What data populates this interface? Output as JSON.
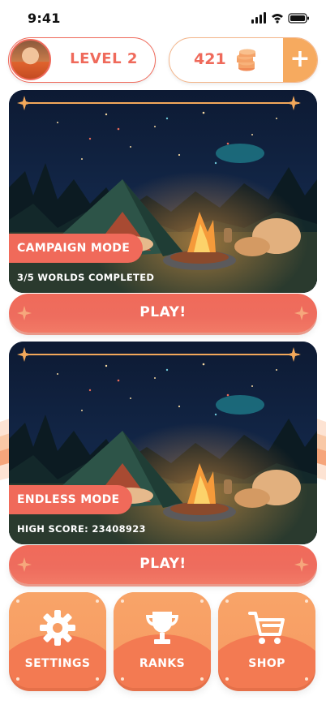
{
  "status_bar": {
    "time": "9:41"
  },
  "header": {
    "level_label": "LEVEL 2",
    "coins": "421",
    "add_coins_symbol": "+"
  },
  "modes": [
    {
      "title": "CAMPAIGN MODE",
      "subtitle": "3/5 WORLDS COMPLETED",
      "play_label": "PLAY!"
    },
    {
      "title": "ENDLESS MODE",
      "subtitle": "HIGH SCORE: 23408923",
      "play_label": "PLAY!"
    }
  ],
  "bottom_nav": [
    {
      "label": "SETTINGS",
      "icon": "gear-icon"
    },
    {
      "label": "RANKS",
      "icon": "trophy-icon"
    },
    {
      "label": "SHOP",
      "icon": "cart-icon"
    }
  ],
  "colors": {
    "accent": "#ef6a5b",
    "orange": "#f79d64",
    "gold": "#f6aa5f",
    "night_sky": "#0f1c33"
  }
}
